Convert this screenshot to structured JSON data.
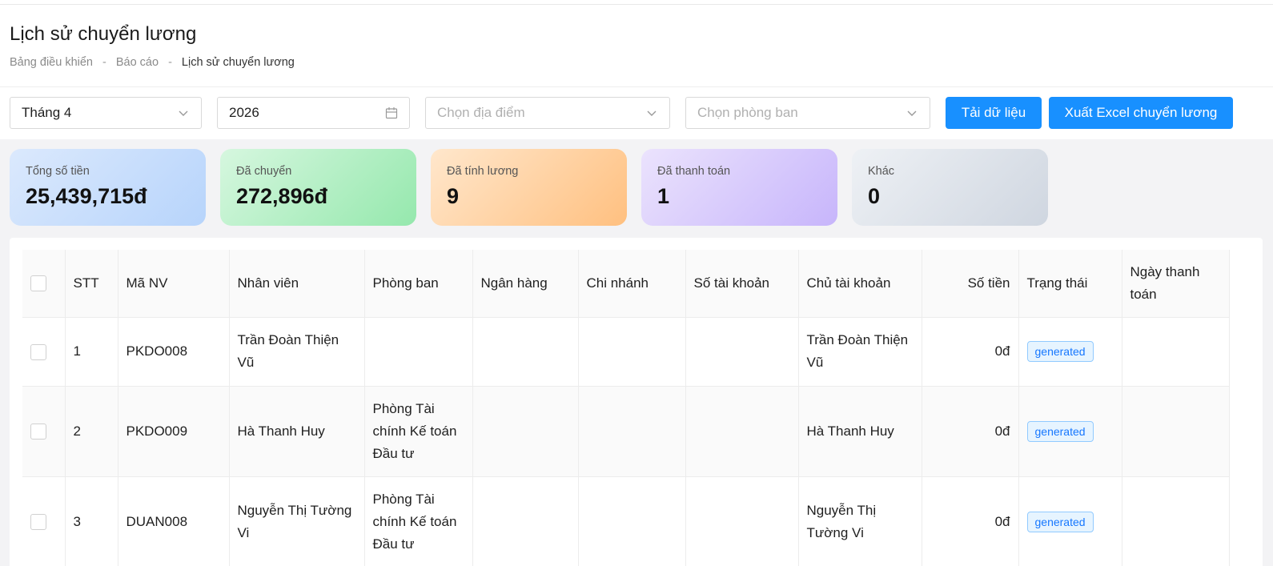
{
  "header": {
    "title": "Lịch sử chuyển lương",
    "breadcrumb": [
      "Bảng điều khiển",
      "Báo cáo",
      "Lịch sử chuyển lương"
    ]
  },
  "filters": {
    "month": "Tháng 4",
    "year": "2026",
    "location_placeholder": "Chọn địa điểm",
    "department_placeholder": "Chọn phòng ban",
    "load_button": "Tải dữ liệu",
    "export_button": "Xuất Excel chuyển lương"
  },
  "summary": [
    {
      "label": "Tổng số tiền",
      "value": "25,439,715đ"
    },
    {
      "label": "Đã chuyển",
      "value": "272,896đ"
    },
    {
      "label": "Đã tính lương",
      "value": "9"
    },
    {
      "label": "Đã thanh toán",
      "value": "1"
    },
    {
      "label": "Khác",
      "value": "0"
    }
  ],
  "table": {
    "columns": [
      "STT",
      "Mã NV",
      "Nhân viên",
      "Phòng ban",
      "Ngân hàng",
      "Chi nhánh",
      "Số tài khoản",
      "Chủ tài khoản",
      "Số tiền",
      "Trạng thái",
      "Ngày thanh toán"
    ],
    "rows": [
      {
        "stt": "1",
        "code": "PKDO008",
        "name": "Trần Đoàn Thiện Vũ",
        "dept": "",
        "bank": "",
        "branch": "",
        "account": "",
        "holder": "Trần Đoàn Thiện Vũ",
        "amount": "0đ",
        "status": "generated",
        "date": ""
      },
      {
        "stt": "2",
        "code": "PKDO009",
        "name": "Hà Thanh Huy",
        "dept": "Phòng Tài chính Kế toán Đầu tư",
        "bank": "",
        "branch": "",
        "account": "",
        "holder": "Hà Thanh Huy",
        "amount": "0đ",
        "status": "generated",
        "date": ""
      },
      {
        "stt": "3",
        "code": "DUAN008",
        "name": "Nguyễn Thị Tường Vi",
        "dept": "Phòng Tài chính Kế toán Đầu tư",
        "bank": "",
        "branch": "",
        "account": "",
        "holder": "Nguyễn Thị Tường Vi",
        "amount": "0đ",
        "status": "generated",
        "date": ""
      }
    ]
  }
}
